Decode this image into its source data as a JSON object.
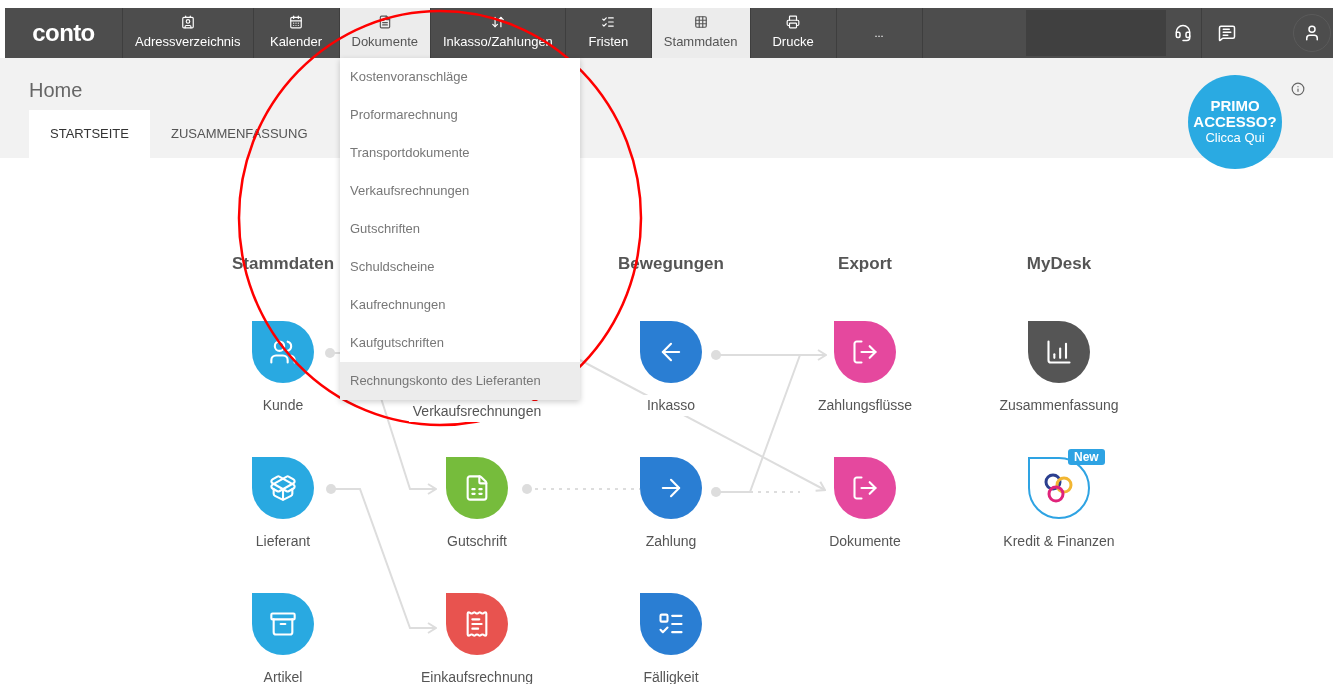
{
  "nav": {
    "logo": "conto",
    "items": [
      {
        "label": "Adressverzeichnis",
        "highlighted": false
      },
      {
        "label": "Kalender",
        "highlighted": false
      },
      {
        "label": "Dokumente",
        "highlighted": true
      },
      {
        "label": "Inkasso/Zahlungen",
        "highlighted": false
      },
      {
        "label": "Fristen",
        "highlighted": false
      },
      {
        "label": "Stammdaten",
        "highlighted": true
      },
      {
        "label": "Drucke",
        "highlighted": false
      },
      {
        "label": "...",
        "highlighted": false
      }
    ]
  },
  "dropdown": [
    {
      "label": "Kostenvoranschläge",
      "highlighted": false
    },
    {
      "label": "Proformarechnung",
      "highlighted": false
    },
    {
      "label": "Transportdokumente",
      "highlighted": false
    },
    {
      "label": "Verkaufsrechnungen",
      "highlighted": false
    },
    {
      "label": "Gutschriften",
      "highlighted": false
    },
    {
      "label": "Schuldscheine",
      "highlighted": false
    },
    {
      "label": "Kaufrechnungen",
      "highlighted": false
    },
    {
      "label": "Kaufgutschriften",
      "highlighted": false
    },
    {
      "label": "Rechnungskonto des Lieferanten",
      "highlighted": true
    }
  ],
  "header": {
    "title": "Home",
    "tabs": [
      {
        "label": "STARTSEITE",
        "selected": true
      },
      {
        "label": "ZUSAMMENFASSUNG",
        "selected": false
      }
    ]
  },
  "promo": {
    "title": "PRIMO ACCESSO?",
    "link": "Clicca Qui"
  },
  "columns": [
    {
      "heading": "Stammdaten",
      "nodes": [
        {
          "label": "Kunde",
          "kind": "drop",
          "color": "#29a9e1"
        },
        {
          "label": "Lieferant",
          "kind": "drop",
          "color": "#29a9e1"
        },
        {
          "label": "Artikel",
          "kind": "drop",
          "color": "#29a9e1"
        }
      ]
    },
    {
      "nodes": [
        {
          "label": "Verkaufsrechnungen",
          "kind": "hidden"
        },
        {
          "label": "Gutschrift",
          "kind": "drop",
          "color": "#76bc3c"
        },
        {
          "label": "Einkaufsrechnung",
          "kind": "drop",
          "color": "#e8534f"
        }
      ]
    },
    {
      "heading": "Bewegungen",
      "nodes": [
        {
          "label": "Inkasso",
          "kind": "drop",
          "color": "#2a7ed3"
        },
        {
          "label": "Zahlung",
          "kind": "drop",
          "color": "#2a7ed3"
        },
        {
          "label": "Fälligkeit",
          "kind": "drop",
          "color": "#2a7ed3"
        }
      ]
    },
    {
      "heading": "Export",
      "nodes": [
        {
          "label": "Zahlungsflüsse",
          "kind": "drop",
          "color": "#e5489e"
        },
        {
          "label": "Dokumente",
          "kind": "drop",
          "color": "#e5489e"
        }
      ]
    },
    {
      "heading": "MyDesk",
      "nodes": [
        {
          "label": "Zusammenfassung",
          "kind": "drop",
          "color": "#555555"
        },
        {
          "label": "Kredit & Finanzen",
          "kind": "outline",
          "color": "#2ea3e3",
          "badge": "New"
        }
      ]
    }
  ]
}
